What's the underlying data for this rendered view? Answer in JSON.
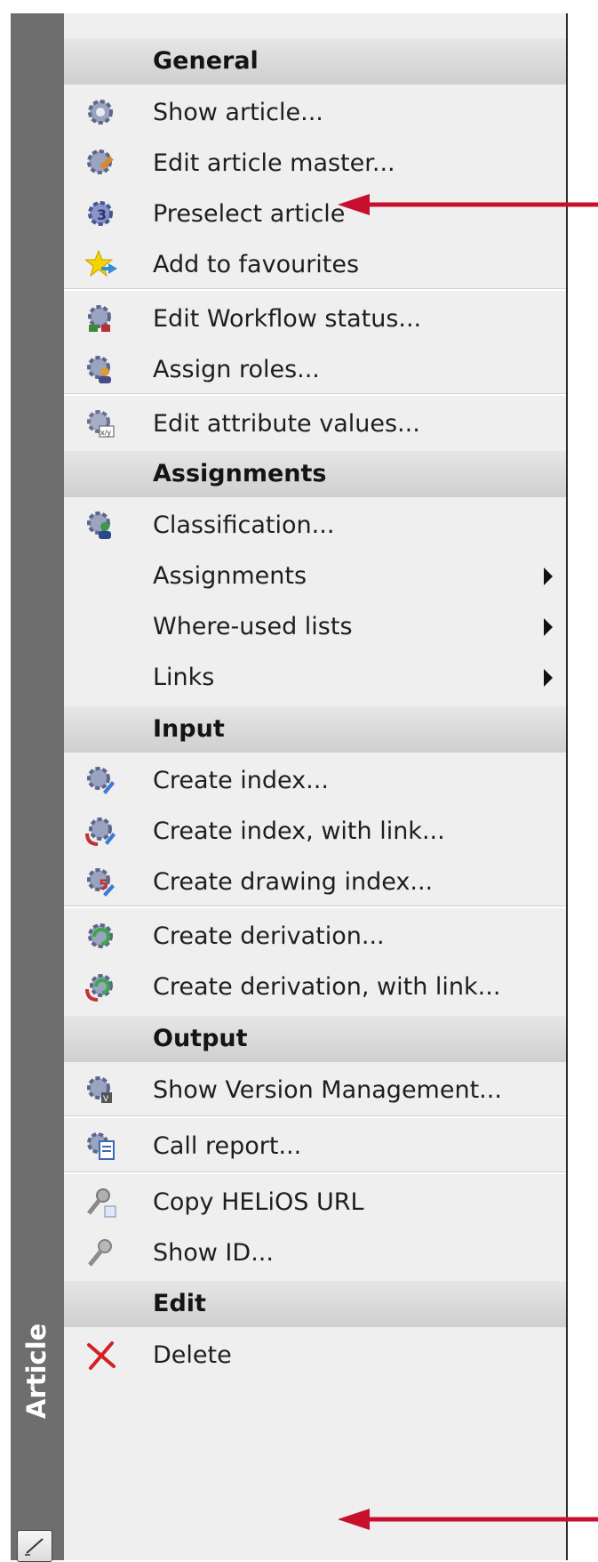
{
  "sidebar": {
    "title": "Article",
    "pencil_icon": "pencil-icon"
  },
  "menu": {
    "sections": [
      {
        "header": "General",
        "items": [
          {
            "label": "Show article...",
            "icon": "gear-view-icon"
          },
          {
            "label": "Edit article master...",
            "icon": "gear-pencil-icon"
          },
          {
            "label": "Preselect article",
            "icon": "gear-3-icon"
          },
          {
            "label": "Add to favourites",
            "icon": "star-arrow-icon"
          },
          {
            "label": "Edit Workflow status...",
            "icon": "gear-workflow-icon"
          },
          {
            "label": "Assign roles...",
            "icon": "gear-user-icon"
          },
          {
            "label": "Edit attribute values...",
            "icon": "gear-attributes-icon"
          }
        ]
      },
      {
        "header": "Assignments",
        "items": [
          {
            "label": "Classification...",
            "icon": "gear-classification-icon"
          },
          {
            "label": "Assignments",
            "submenu": true
          },
          {
            "label": "Where-used lists",
            "submenu": true
          },
          {
            "label": "Links",
            "submenu": true
          }
        ]
      },
      {
        "header": "Input",
        "items": [
          {
            "label": "Create index...",
            "icon": "gear-index-icon"
          },
          {
            "label": "Create index, with link...",
            "icon": "gear-index-link-icon"
          },
          {
            "label": "Create drawing index...",
            "icon": "gear-drawing-index-icon"
          },
          {
            "label": "Create derivation...",
            "icon": "gear-derivation-icon"
          },
          {
            "label": "Create derivation, with link...",
            "icon": "gear-derivation-link-icon"
          }
        ]
      },
      {
        "header": "Output",
        "items": [
          {
            "label": "Show Version Management...",
            "icon": "gear-version-icon"
          },
          {
            "label": "Call report...",
            "icon": "gear-report-icon"
          },
          {
            "label": "Copy HELiOS URL",
            "icon": "key-copy-icon"
          },
          {
            "label": "Show ID...",
            "icon": "key-icon"
          }
        ]
      },
      {
        "header": "Edit",
        "items": [
          {
            "label": "Delete",
            "icon": "red-x-icon"
          }
        ]
      }
    ]
  },
  "colors": {
    "arrow": "#c8102e",
    "sidebar": "#6e6e6e",
    "menu_bg": "#efefef",
    "header_bg": "#d8d8d8"
  }
}
